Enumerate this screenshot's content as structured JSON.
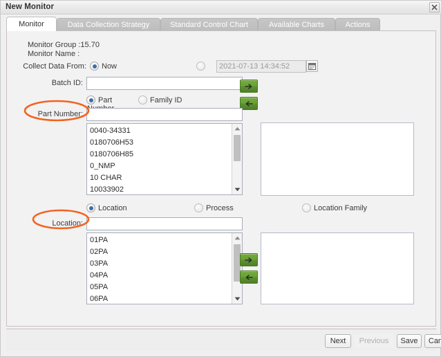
{
  "window": {
    "title": "New Monitor",
    "close_icon": "close-icon"
  },
  "tabs": [
    {
      "label": "Monitor",
      "active": true
    },
    {
      "label": "Data Collection Strategy",
      "active": false
    },
    {
      "label": "Standard Control Chart",
      "active": false
    },
    {
      "label": "Available Charts",
      "active": false
    },
    {
      "label": "Actions",
      "active": false
    }
  ],
  "form": {
    "monitor_group_label": "Monitor Group :15.70",
    "monitor_name_label": "Monitor Name :",
    "collect_data_from_label": "Collect Data From:",
    "now_radio_label": "Now",
    "datetime_value": "2021-07-13 14:34:52",
    "calendar_icon": "calendar-icon",
    "batch_id_label": "Batch ID:",
    "batch_id_value": "",
    "part_radio_label": "Part",
    "family_id_radio_label": "Family ID",
    "part_number_label": "Part Number:",
    "part_number_hidden_label": "Number",
    "part_number_value": "",
    "location_radio_label": "Location",
    "process_radio_label": "Process",
    "location_family_radio_label": "Location Family",
    "location_label": "Location:",
    "location_value": ""
  },
  "part_list": {
    "items": [
      "0040-34331",
      "0180706H53",
      "0180706H85",
      "0_NMP",
      "10 CHAR",
      "10033902"
    ],
    "scroll_up_icon": "triangle-up-icon",
    "scroll_down_icon": "triangle-down-icon"
  },
  "location_list": {
    "items": [
      "01PA",
      "02PA",
      "03PA",
      "04PA",
      "05PA",
      "06PA"
    ],
    "scroll_up_icon": "triangle-up-icon",
    "scroll_down_icon": "triangle-down-icon"
  },
  "transfer_buttons": {
    "part_add_icon": "arrow-right-icon",
    "part_remove_icon": "arrow-left-icon",
    "location_add_icon": "arrow-right-icon",
    "location_remove_icon": "arrow-left-icon"
  },
  "selected_parts": [],
  "selected_locations": [],
  "footer": {
    "next_label": "Next",
    "previous_label": "Previous",
    "save_label": "Save",
    "cancel_label": "Cancel"
  },
  "annotations": {
    "color": "#f4621f",
    "part_number_ellipse": "part-number-highlight",
    "location_ellipse": "location-highlight"
  }
}
